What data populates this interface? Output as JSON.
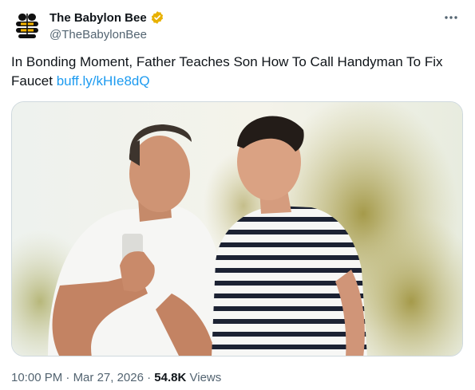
{
  "author": {
    "display_name": "The Babylon Bee",
    "handle": "@TheBabylonBee",
    "verified": true,
    "avatar_icon": "bee-logo-icon",
    "verified_icon": "gold-verified-badge-icon",
    "verified_color": "#e8b100"
  },
  "more_icon": "more-options-icon",
  "tweet": {
    "text": "In Bonding Moment, Father Teaches Son How To Call Handyman To Fix Faucet",
    "link": "buff.ly/kHIe8dQ",
    "link_color": "#1d9bf0"
  },
  "media": {
    "description_icon": "photo-father-son-phone"
  },
  "meta": {
    "time": "10:00 PM",
    "separator1": "·",
    "date": "Mar 27, 2026",
    "separator2": "·",
    "views_count": "54.8K",
    "views_label": "Views"
  }
}
